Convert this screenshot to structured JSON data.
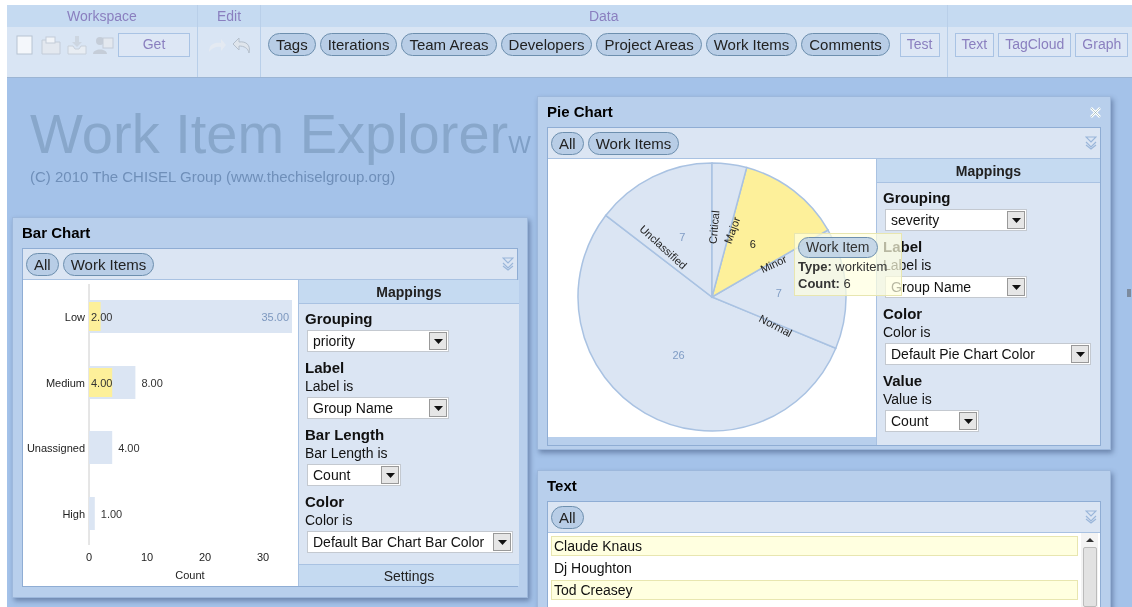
{
  "toolbar": {
    "sections": [
      {
        "title": "Workspace",
        "items": [
          {
            "kind": "icon"
          },
          {
            "kind": "icon"
          },
          {
            "kind": "icon"
          },
          {
            "kind": "icon"
          },
          {
            "kind": "square",
            "label": "Get"
          }
        ]
      },
      {
        "title": "Edit",
        "items": [
          {
            "kind": "icon"
          },
          {
            "kind": "icon"
          }
        ]
      },
      {
        "title": "Data",
        "items": [
          {
            "kind": "pill",
            "label": "Tags"
          },
          {
            "kind": "pill",
            "label": "Iterations"
          },
          {
            "kind": "pill",
            "label": "Team Areas"
          },
          {
            "kind": "pill",
            "label": "Developers"
          },
          {
            "kind": "pill",
            "label": "Project Areas"
          },
          {
            "kind": "pill",
            "label": "Work Items"
          },
          {
            "kind": "pill",
            "label": "Comments"
          },
          {
            "kind": "square",
            "label": "Test"
          }
        ]
      },
      {
        "items": [
          {
            "kind": "square",
            "label": "Text"
          },
          {
            "kind": "square",
            "label": "TagCloud"
          },
          {
            "kind": "square",
            "label": "Graph"
          }
        ]
      }
    ]
  },
  "app_title": "Work Item Explorer",
  "app_subtitle": "W",
  "copyright": "(C) 2010 The CHISEL Group (www.thechiselgroup.org)",
  "bar_chart_window": {
    "title": "Bar Chart",
    "filters": [
      "All",
      "Work Items"
    ],
    "chart_data": {
      "type": "bar",
      "orientation": "horizontal",
      "stacked": false,
      "categories": [
        "Low",
        "Medium",
        "Unassigned",
        "High"
      ],
      "series": [
        {
          "color": "#dbe5f3",
          "values": [
            35,
            8,
            4,
            1
          ],
          "value_labels": [
            "35.00",
            "8.00",
            "4.00",
            "1.00"
          ]
        },
        {
          "color": "#fdf09a",
          "values": [
            2,
            4,
            0,
            0
          ],
          "value_labels": [
            "2.00",
            "4.00",
            null,
            null
          ]
        }
      ],
      "xlabel": "Count",
      "xticks": [
        0,
        10,
        20,
        30
      ],
      "xlim": [
        0,
        35
      ]
    },
    "mappings": {
      "title": "Mappings",
      "groups": [
        {
          "heading": "Grouping",
          "field": "priority"
        },
        {
          "heading": "Label",
          "caption": "Label is",
          "field": "Group Name"
        },
        {
          "heading": "Bar Length",
          "caption": "Bar Length is",
          "field": "Count"
        },
        {
          "heading": "Color",
          "caption": "Color is",
          "field": "Default Bar Chart Bar Color"
        }
      ]
    },
    "footer": "Settings"
  },
  "pie_chart_window": {
    "title": "Pie Chart",
    "filters": [
      "All",
      "Work Items"
    ],
    "chart_data": {
      "type": "pie",
      "categories": [
        "Critical",
        "Major",
        "Minor",
        "Normal",
        "Unclassified"
      ],
      "series": [
        {
          "colors": [
            "#dbe5f3",
            "#fdf09a",
            "#dbe5f3",
            "#dbe5f3",
            "#dbe5f3"
          ],
          "values": [
            2,
            6,
            7,
            26,
            7
          ],
          "value_labels": [
            null,
            "6",
            "7",
            "26",
            "7"
          ]
        }
      ]
    },
    "tooltip": {
      "title": "Work Item",
      "lines": [
        "**Type:** workitem",
        "**Count:** 6"
      ]
    },
    "mappings": {
      "title": "Mappings",
      "groups": [
        {
          "heading": "Grouping",
          "field": "severity"
        },
        {
          "heading": "Label",
          "caption": "Label is",
          "field": "Group Name"
        },
        {
          "heading": "Color",
          "caption": "Color is",
          "field": "Default Pie Chart Color"
        },
        {
          "heading": "Value",
          "caption": "Value is",
          "field": "Count"
        }
      ]
    }
  },
  "text_window": {
    "title": "Text",
    "filters": [
      "All"
    ],
    "rows": [
      {
        "text": "Claude Knaus",
        "highlighted": true
      },
      {
        "text": "Dj Houghton",
        "highlighted": false
      },
      {
        "text": "Tod Creasey",
        "highlighted": true
      }
    ]
  }
}
